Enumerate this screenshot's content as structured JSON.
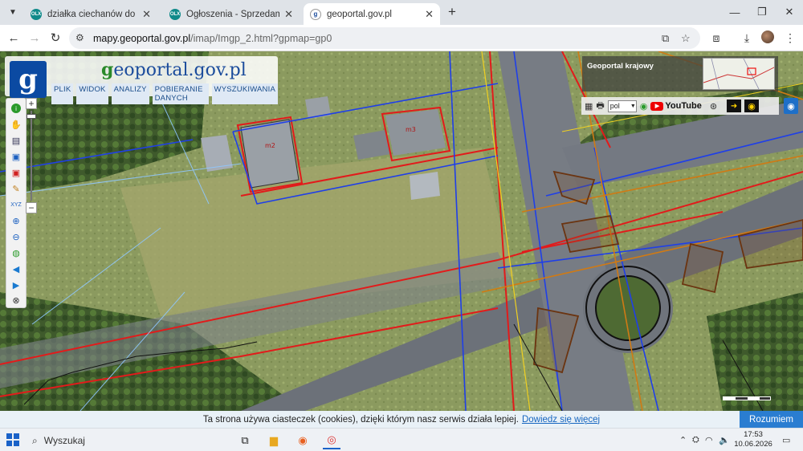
{
  "browser": {
    "tabs": [
      {
        "title": "działka ciechanów do sprzedani",
        "favicon": "olx-icon"
      },
      {
        "title": "Ogłoszenia - Sprzedam, kupię n",
        "favicon": "olx-icon"
      },
      {
        "title": "geoportal.gov.pl",
        "favicon": "geoportal-icon"
      }
    ],
    "url_domain": "mapy.geoportal.gov.pl",
    "url_path": "/imap/Imgp_2.html?gpmap=gp0"
  },
  "geoportal": {
    "logo_text_prefix": "g",
    "logo_text": "eoportal.gov.pl",
    "menu": [
      "PLIK",
      "WIDOK",
      "ANALIZY",
      "POBIERANIE DANYCH",
      "WYSZUKIWANIA"
    ],
    "overview_label": "Geoportal krajowy",
    "language": "pol",
    "youtube_label": "YouTube",
    "tools": [
      "info-icon",
      "pan-icon",
      "layers-icon",
      "select-icon",
      "clear-icon",
      "measure-icon",
      "xyz-icon",
      "zoom-in-icon",
      "zoom-out-icon",
      "globe-icon",
      "back-icon",
      "forward-icon",
      "extent-icon"
    ]
  },
  "cookie": {
    "text": "Ta strona używa ciasteczek (cookies), dzięki którym nasz serwis działa lepiej.",
    "link": "Dowiedz się więcej",
    "button": "Rozumiem"
  },
  "taskbar": {
    "search_placeholder": "Wyszukaj",
    "time": "17:53",
    "date": "10.06.2026"
  },
  "colors": {
    "accent": "#2a7dd1",
    "geoportal_blue": "#0b4aa2"
  }
}
